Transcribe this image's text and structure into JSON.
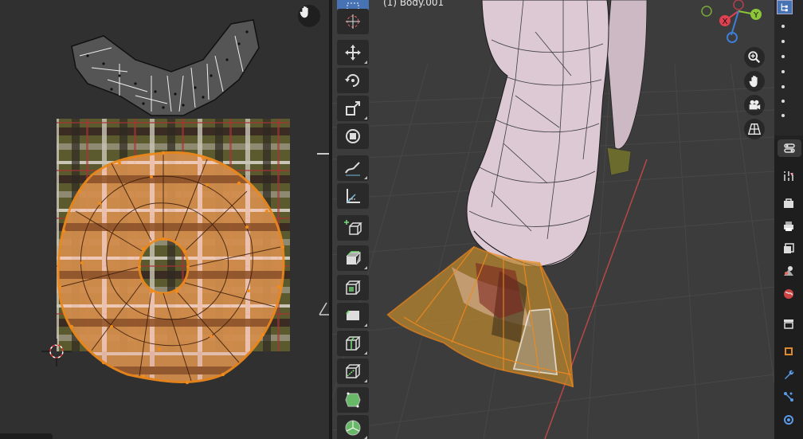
{
  "uv_editor": {
    "cursor_icon": "3d-cursor-icon",
    "hand_icon": "hand-pan-icon"
  },
  "viewport": {
    "object_label": "(1) Body.001",
    "colors": {
      "background": "#3c3c3c",
      "mesh_body": "#dcc9d4",
      "selection": "#f08a1c",
      "x_axis_line": "#b84848"
    }
  },
  "toolbar": {
    "tools": [
      {
        "name": "select-tool",
        "icon": "select-box-icon",
        "active": true
      },
      {
        "name": "cursor-tool",
        "icon": "cursor-icon"
      },
      {
        "name": "move-tool",
        "icon": "move-icon"
      },
      {
        "name": "rotate-tool",
        "icon": "rotate-icon"
      },
      {
        "name": "scale-tool",
        "icon": "scale-icon"
      },
      {
        "name": "transform-tool",
        "icon": "transform-icon"
      },
      {
        "name": "annotate-tool",
        "icon": "annotate-icon"
      },
      {
        "name": "measure-tool",
        "icon": "measure-icon"
      },
      {
        "name": "add-cube-tool",
        "icon": "add-cube-icon"
      },
      {
        "name": "extrude-tool",
        "icon": "extrude-icon"
      },
      {
        "name": "inset-tool",
        "icon": "inset-icon"
      },
      {
        "name": "bevel-tool",
        "icon": "bevel-icon"
      },
      {
        "name": "loop-cut-tool",
        "icon": "loop-cut-icon"
      },
      {
        "name": "knife-tool",
        "icon": "knife-icon"
      },
      {
        "name": "poly-build-tool",
        "icon": "poly-build-icon"
      },
      {
        "name": "spin-tool",
        "icon": "spin-icon"
      }
    ]
  },
  "gizmo": {
    "x_label": "X",
    "y_label": "Y",
    "colors": {
      "x": "#e0404f",
      "y": "#8cc43a",
      "z": "#3e7fd6"
    }
  },
  "nav_buttons": [
    "zoom-icon",
    "hand-pan-icon",
    "camera-icon",
    "grid-icon"
  ],
  "properties_tabs": [
    "tool-icon",
    "render-icon",
    "output-icon",
    "view-layer-icon",
    "scene-icon",
    "world-icon",
    "collection-icon",
    "object-icon",
    "modifier-icon",
    "particles-icon",
    "physics-icon"
  ]
}
